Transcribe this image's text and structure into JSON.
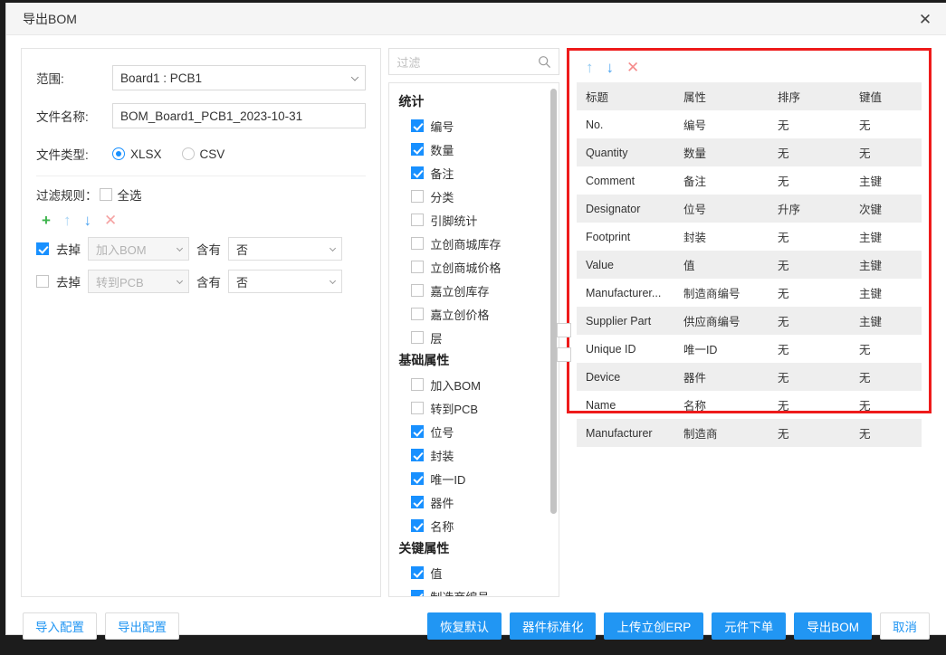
{
  "window": {
    "title": "导出BOM",
    "close_icon": "close-icon"
  },
  "left": {
    "scope_label": "范围:",
    "scope_value": "Board1 : PCB1",
    "filename_label": "文件名称:",
    "filename_value": "BOM_Board1_PCB1_2023-10-31",
    "filetype_label": "文件类型:",
    "filetype_options": [
      "XLSX",
      "CSV"
    ],
    "filetype_selected": "XLSX",
    "filter_rules_label": "过滤规则：",
    "select_all_label": "全选",
    "select_all_checked": false,
    "toolbar": {
      "add": "+",
      "up": "↑",
      "down": "↓",
      "delete": "✕",
      "add_color": "#3cb44b",
      "up_color": "#a8d4f5",
      "down_color": "#4ba3f0",
      "delete_color": "#f5a3a3"
    },
    "rules": [
      {
        "checked": true,
        "action": "去掉",
        "field": "加入BOM",
        "op": "含有",
        "value": "否"
      },
      {
        "checked": false,
        "action": "去掉",
        "field": "转到PCB",
        "op": "含有",
        "value": "否"
      }
    ]
  },
  "middle": {
    "search_placeholder": "过滤",
    "search_icon": "search-icon",
    "groups": [
      {
        "title": "统计",
        "options": [
          {
            "label": "编号",
            "checked": true
          },
          {
            "label": "数量",
            "checked": true
          },
          {
            "label": "备注",
            "checked": true
          },
          {
            "label": "分类",
            "checked": false
          },
          {
            "label": "引脚统计",
            "checked": false
          },
          {
            "label": "立创商城库存",
            "checked": false
          },
          {
            "label": "立创商城价格",
            "checked": false
          },
          {
            "label": "嘉立创库存",
            "checked": false
          },
          {
            "label": "嘉立创价格",
            "checked": false
          },
          {
            "label": "层",
            "checked": false
          }
        ]
      },
      {
        "title": "基础属性",
        "options": [
          {
            "label": "加入BOM",
            "checked": false
          },
          {
            "label": "转到PCB",
            "checked": false
          },
          {
            "label": "位号",
            "checked": true
          },
          {
            "label": "封装",
            "checked": true
          },
          {
            "label": "唯一ID",
            "checked": true
          },
          {
            "label": "器件",
            "checked": true
          },
          {
            "label": "名称",
            "checked": true
          }
        ]
      },
      {
        "title": "关键属性",
        "options": [
          {
            "label": "值",
            "checked": true
          },
          {
            "label": "制造商编号",
            "checked": true
          }
        ]
      }
    ]
  },
  "right": {
    "toolbar": {
      "up": "↑",
      "down": "↓",
      "delete": "✕"
    },
    "columns": [
      "标题",
      "属性",
      "排序",
      "键值"
    ],
    "rows": [
      [
        "No.",
        "编号",
        "无",
        "无"
      ],
      [
        "Quantity",
        "数量",
        "无",
        "无"
      ],
      [
        "Comment",
        "备注",
        "无",
        "主键"
      ],
      [
        "Designator",
        "位号",
        "升序",
        "次键"
      ],
      [
        "Footprint",
        "封装",
        "无",
        "主键"
      ],
      [
        "Value",
        "值",
        "无",
        "主键"
      ],
      [
        "Manufacturer...",
        "制造商编号",
        "无",
        "主键"
      ],
      [
        "Supplier Part",
        "供应商编号",
        "无",
        "主键"
      ],
      [
        "Unique ID",
        "唯一ID",
        "无",
        "无"
      ],
      [
        "Device",
        "器件",
        "无",
        "无"
      ],
      [
        "Name",
        "名称",
        "无",
        "无"
      ],
      [
        "Manufacturer",
        "制造商",
        "无",
        "无"
      ]
    ]
  },
  "footer": {
    "left_buttons": [
      "导入配置",
      "导出配置"
    ],
    "right_buttons": [
      "恢复默认",
      "器件标准化",
      "上传立创ERP",
      "元件下单",
      "导出BOM"
    ],
    "cancel": "取消"
  },
  "colors": {
    "primary": "#2196f3",
    "checkbox": "#1890ff",
    "highlight_border": "#ee1b1b"
  }
}
